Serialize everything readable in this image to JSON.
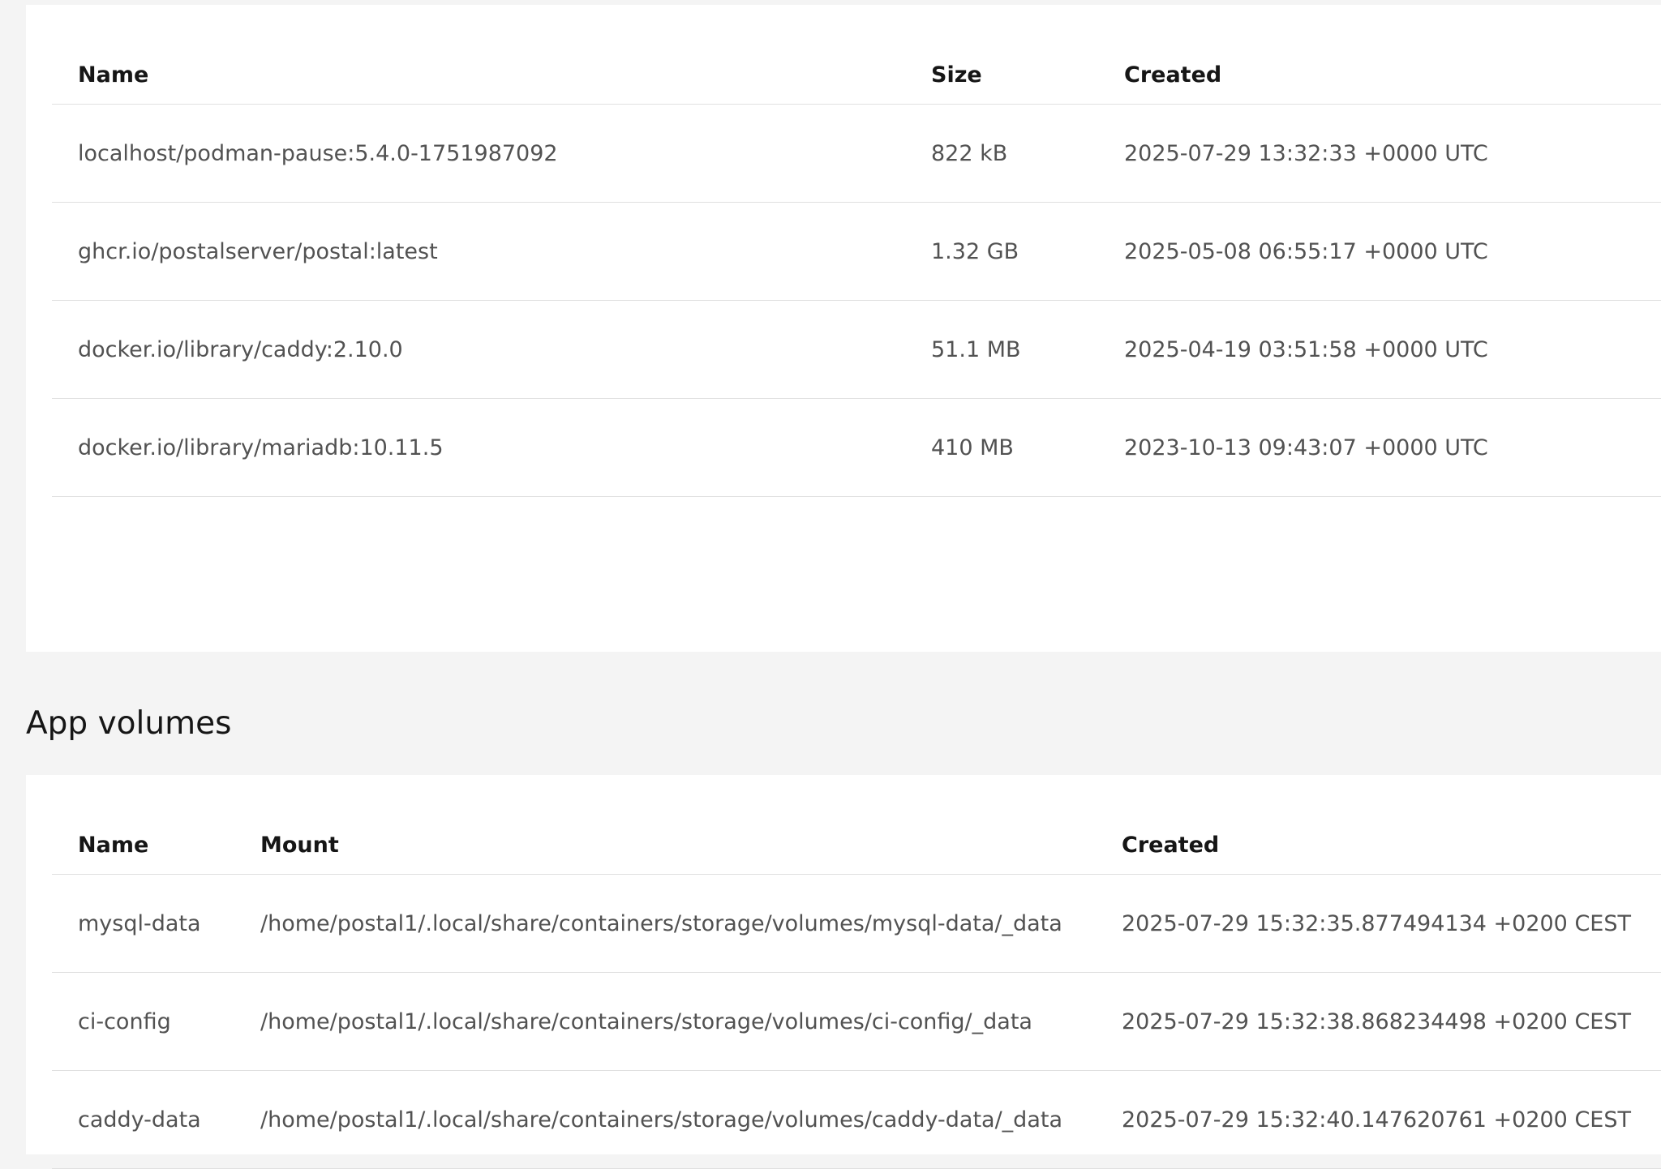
{
  "images": {
    "columns": [
      "Name",
      "Size",
      "Created"
    ],
    "rows": [
      {
        "name": "localhost/podman-pause:5.4.0-1751987092",
        "size": "822 kB",
        "created": "2025-07-29 13:32:33 +0000 UTC"
      },
      {
        "name": "ghcr.io/postalserver/postal:latest",
        "size": "1.32 GB",
        "created": "2025-05-08 06:55:17 +0000 UTC"
      },
      {
        "name": "docker.io/library/caddy:2.10.0",
        "size": "51.1 MB",
        "created": "2025-04-19 03:51:58 +0000 UTC"
      },
      {
        "name": "docker.io/library/mariadb:10.11.5",
        "size": "410 MB",
        "created": "2023-10-13 09:43:07 +0000 UTC"
      }
    ]
  },
  "volumes": {
    "title": "App volumes",
    "columns": [
      "Name",
      "Mount",
      "Created"
    ],
    "rows": [
      {
        "name": "mysql-data",
        "mount": "/home/postal1/.local/share/containers/storage/volumes/mysql-data/_data",
        "created": "2025-07-29 15:32:35.877494134 +0200 CEST"
      },
      {
        "name": "ci-config",
        "mount": "/home/postal1/.local/share/containers/storage/volumes/ci-config/_data",
        "created": "2025-07-29 15:32:38.868234498 +0200 CEST"
      },
      {
        "name": "caddy-data",
        "mount": "/home/postal1/.local/share/containers/storage/volumes/caddy-data/_data",
        "created": "2025-07-29 15:32:40.147620761 +0200 CEST"
      }
    ]
  }
}
